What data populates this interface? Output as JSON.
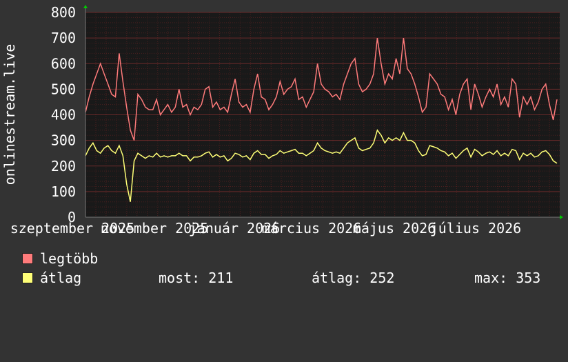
{
  "chart_data": {
    "type": "line",
    "ylabel": "onlinestream.live",
    "ylim": [
      0,
      800
    ],
    "yticks": [
      0,
      100,
      200,
      300,
      400,
      500,
      600,
      700,
      800
    ],
    "x_tick_labels": [
      "szeptember 2025",
      "november 2025",
      "január 2026",
      "március 2026",
      "május 2026",
      "július 2026"
    ],
    "grid": true,
    "colors": {
      "background": "#333333",
      "plot_bg": "#191919",
      "grid": "#4a1f1f",
      "axis": "#777777",
      "arrow": "#00cc00",
      "max_series": "#ff7b7b",
      "avg_series": "#ffff77"
    },
    "series": [
      {
        "name": "legtöbb",
        "color": "#ff7b7b",
        "values": [
          410,
          470,
          520,
          560,
          600,
          560,
          520,
          480,
          470,
          640,
          530,
          430,
          340,
          300,
          480,
          460,
          430,
          420,
          420,
          460,
          400,
          420,
          440,
          410,
          430,
          500,
          430,
          440,
          400,
          430,
          420,
          440,
          500,
          510,
          430,
          450,
          420,
          430,
          410,
          480,
          540,
          450,
          430,
          440,
          410,
          500,
          560,
          470,
          460,
          420,
          440,
          470,
          530,
          480,
          500,
          510,
          540,
          460,
          470,
          430,
          460,
          490,
          600,
          520,
          500,
          490,
          470,
          480,
          460,
          520,
          560,
          600,
          620,
          520,
          490,
          500,
          520,
          560,
          700,
          600,
          520,
          560,
          540,
          620,
          560,
          700,
          580,
          560,
          520,
          470,
          410,
          430,
          560,
          540,
          520,
          480,
          470,
          420,
          460,
          400,
          480,
          520,
          540,
          420,
          520,
          480,
          430,
          470,
          500,
          470,
          520,
          440,
          470,
          430,
          540,
          520,
          390,
          470,
          440,
          470,
          420,
          450,
          500,
          520,
          440,
          380,
          460
        ]
      },
      {
        "name": "átlag",
        "color": "#ffff77",
        "values": [
          240,
          270,
          290,
          260,
          250,
          270,
          280,
          260,
          250,
          280,
          240,
          130,
          60,
          220,
          250,
          240,
          230,
          240,
          235,
          250,
          235,
          240,
          235,
          240,
          240,
          250,
          240,
          240,
          220,
          235,
          235,
          240,
          250,
          255,
          235,
          245,
          235,
          240,
          220,
          230,
          250,
          245,
          235,
          240,
          225,
          250,
          260,
          245,
          245,
          230,
          240,
          245,
          260,
          250,
          255,
          260,
          265,
          250,
          250,
          240,
          250,
          260,
          290,
          270,
          260,
          255,
          250,
          255,
          250,
          270,
          290,
          300,
          310,
          270,
          260,
          265,
          270,
          290,
          340,
          320,
          290,
          310,
          300,
          310,
          300,
          330,
          300,
          300,
          290,
          260,
          240,
          245,
          280,
          275,
          270,
          260,
          255,
          240,
          250,
          230,
          245,
          260,
          270,
          235,
          265,
          255,
          240,
          250,
          255,
          245,
          260,
          240,
          250,
          240,
          265,
          260,
          225,
          250,
          240,
          250,
          235,
          240,
          255,
          260,
          245,
          220,
          211
        ]
      }
    ],
    "stats": {
      "most": 211,
      "atlag": 252,
      "max": 353
    }
  },
  "legend": {
    "max_label": "legtöbb",
    "avg_label": "átlag",
    "most_label": "most: 211",
    "atlag_label": "átlag: 252",
    "max_stat_label": "max: 353"
  }
}
